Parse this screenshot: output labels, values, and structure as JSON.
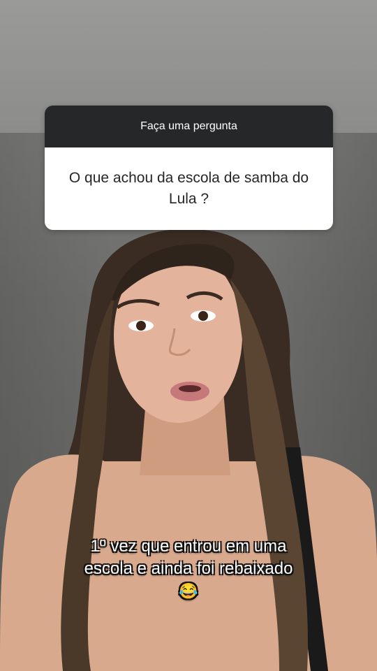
{
  "question_sticker": {
    "header": "Faça uma pergunta",
    "question": "O que achou da escola de samba do Lula ?"
  },
  "caption": {
    "line1": "1º vez que entrou em uma",
    "line2": "escola e ainda foi rebaixado",
    "emoji": "😂"
  },
  "colors": {
    "card_header_bg": "#262729",
    "card_body_bg": "#ffffff",
    "caption_text": "#ffffff"
  },
  "icons": [
    "laughing-tears-emoji-icon"
  ]
}
